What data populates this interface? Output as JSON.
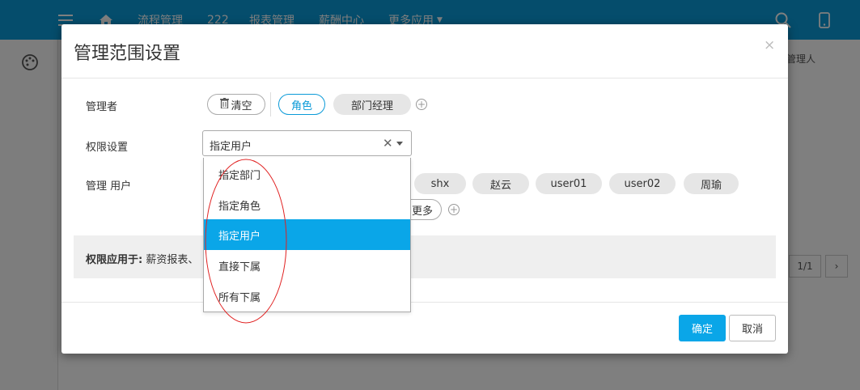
{
  "topnav": {
    "items": [
      "流程管理",
      "222",
      "报表管理",
      "薪酬中心",
      "更多应用"
    ]
  },
  "background": {
    "right_label": "管理人",
    "pager": "1/1"
  },
  "modal": {
    "title": "管理范围设置",
    "close": "×",
    "manager_label": "管理者",
    "clear_label": "清空",
    "manager_tags": [
      "角色",
      "部门经理"
    ],
    "permission_label": "权限设置",
    "permission_value": "指定用户",
    "users_label": "管理 用户",
    "user_tags": [
      "shx",
      "赵云",
      "user01",
      "user02",
      "周瑜"
    ],
    "more_label": "更多",
    "applies_label": "权限应用于:",
    "applies_value": "薪资报表、",
    "confirm_label": "确定",
    "cancel_label": "取消"
  },
  "dropdown": {
    "options": [
      "指定部门",
      "指定角色",
      "指定用户",
      "直接下属",
      "所有下属"
    ],
    "selected_index": 2
  },
  "colors": {
    "primary": "#0a9ad8",
    "annotation": "#e02020"
  }
}
